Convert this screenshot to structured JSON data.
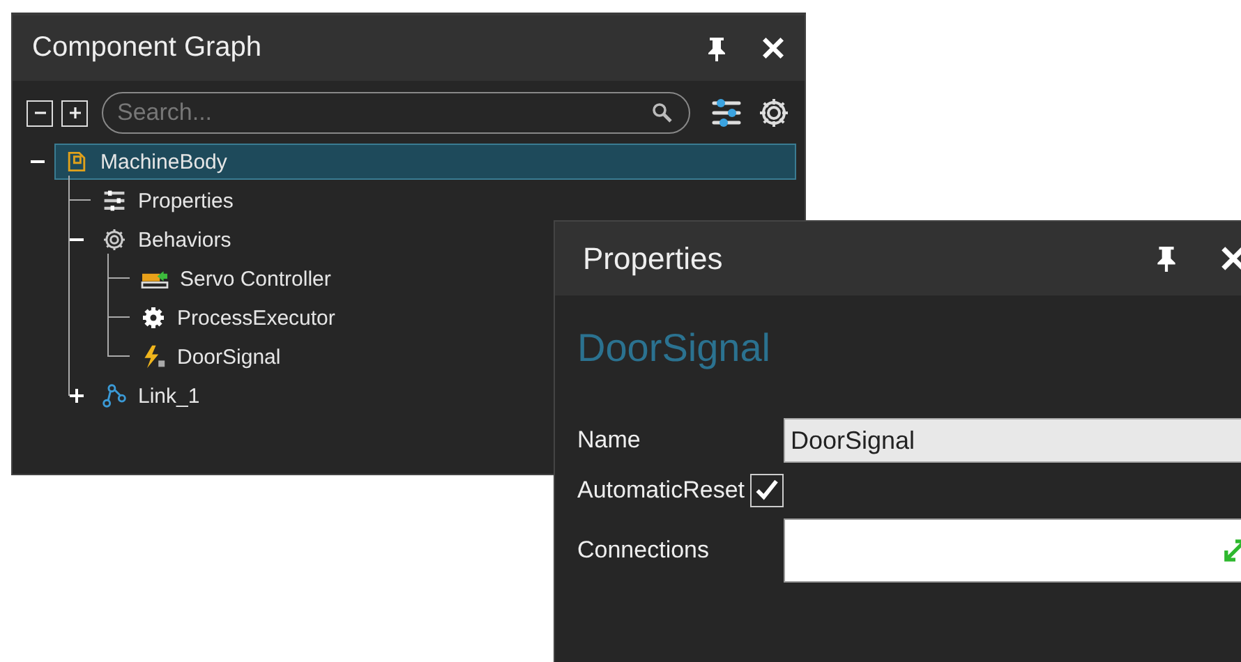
{
  "component_graph": {
    "title": "Component Graph",
    "search": {
      "placeholder": "Search..."
    },
    "tree": [
      {
        "label": "MachineBody",
        "kind": "component",
        "selected": true,
        "expanded": true,
        "children": [
          {
            "label": "Properties",
            "kind": "properties",
            "selected": false
          },
          {
            "label": "Behaviors",
            "kind": "behaviors",
            "selected": false,
            "expanded": true,
            "children": [
              {
                "label": "Servo Controller",
                "kind": "servo",
                "selected": false
              },
              {
                "label": "ProcessExecutor",
                "kind": "executor",
                "selected": false
              },
              {
                "label": "DoorSignal",
                "kind": "signal",
                "selected": false
              }
            ]
          },
          {
            "label": "Link_1",
            "kind": "link",
            "selected": false,
            "expanded": false
          }
        ]
      }
    ]
  },
  "properties": {
    "title": "Properties",
    "heading": "DoorSignal",
    "fields": [
      {
        "kind": "text",
        "label": "Name",
        "value": "DoorSignal"
      },
      {
        "kind": "checkbox",
        "label": "AutomaticReset",
        "checked": true
      },
      {
        "kind": "collection",
        "label": "Connections"
      }
    ]
  }
}
